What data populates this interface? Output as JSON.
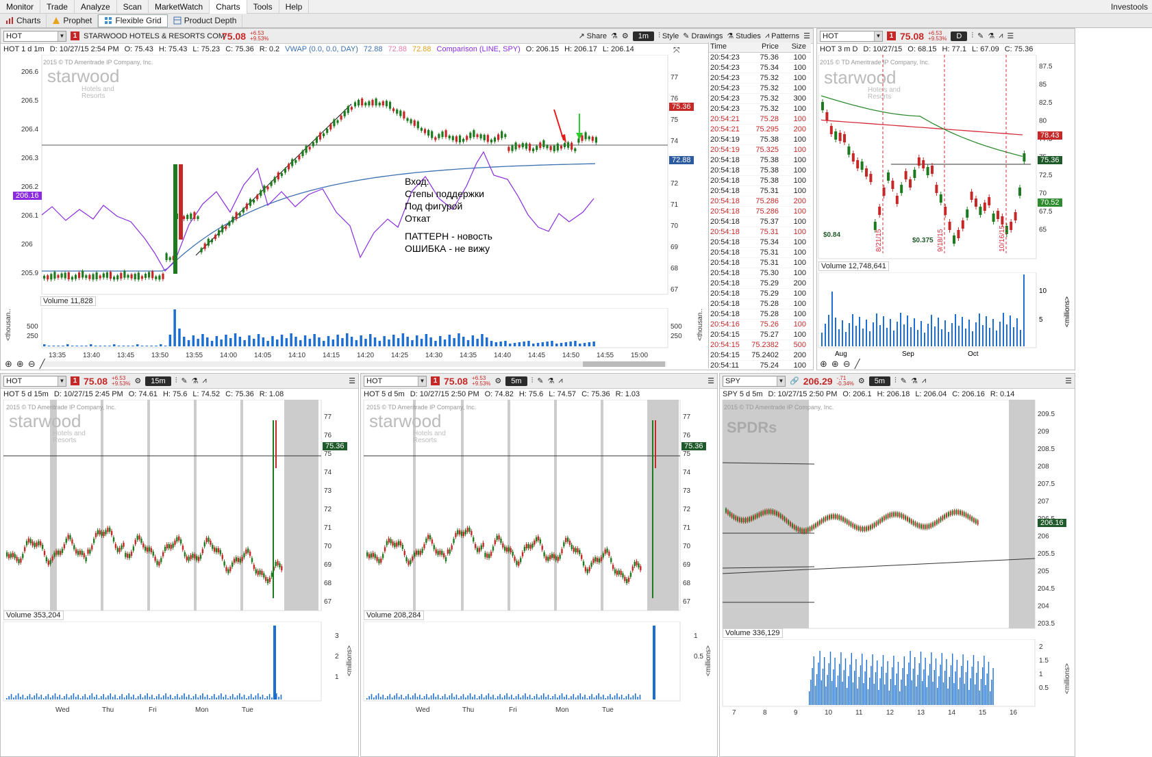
{
  "menubar": {
    "items": [
      "Monitor",
      "Trade",
      "Analyze",
      "Scan",
      "MarketWatch",
      "Charts",
      "Tools",
      "Help"
    ],
    "active": "Charts",
    "brand": "Investools"
  },
  "subtabs": {
    "items": [
      "Charts",
      "Prophet",
      "Flexible Grid",
      "Product Depth"
    ],
    "active": "Flexible Grid"
  },
  "main_chart": {
    "symbol": "HOT",
    "alert_count": "1",
    "company_name": "STARWOOD HOTELS & RESORTS COM",
    "last_price": "75.08",
    "change": "+6.53",
    "change_pct": "+9.53%",
    "timeframe": "1m",
    "toolbar": {
      "share": "Share",
      "style": "Style",
      "drawings": "Drawings",
      "studies": "Studies",
      "patterns": "Patterns"
    },
    "info": {
      "desc": "HOT 1 d 1m",
      "date": "D: 10/27/15 2:54 PM",
      "open": "O: 75.43",
      "high": "H: 75.43",
      "low": "L: 75.23",
      "close": "C: 75.36",
      "range": "R: 0.2",
      "vwap": "VWAP (0.0, 0.0, DAY)",
      "vwap_v1": "72.88",
      "vwap_v2": "72.88",
      "vwap_v3": "72.88",
      "comparison": "Comparison (LINE, SPY)",
      "cmp_open": "O: 206.15",
      "cmp_high": "H: 206.17",
      "cmp_low": "L: 206.14"
    },
    "watermark": {
      "brand": "starwood",
      "sub1": "Hotels and",
      "sub2": "Resorts",
      "copyright": "2015 © TD Ameritrade IP Company, Inc."
    },
    "right_axis": [
      "77",
      "76",
      "75",
      "74",
      "73",
      "72",
      "71",
      "70",
      "69",
      "68",
      "67"
    ],
    "left_axis": [
      "206.6",
      "206.5",
      "206.4",
      "206.3",
      "206.2",
      "206.1",
      "206",
      "205.9"
    ],
    "price_label": "75.36",
    "vwap_label": "72.88",
    "spy_label": "206.16",
    "annotation": {
      "line1": "Вход:",
      "line2": "Степы поддержки",
      "line3": "Под фигурой",
      "line4": "Откат",
      "line5": "ПАТТЕРН - новость",
      "line6": "ОШИБКА - не вижу"
    },
    "volume": {
      "label": "Volume",
      "value": "11,828",
      "axis_left": [
        "500",
        "250"
      ],
      "axis_right": [
        "500",
        "250"
      ],
      "unit": "<thousan..."
    },
    "time_axis": [
      "13:35",
      "13:40",
      "13:45",
      "13:50",
      "13:55",
      "14:00",
      "14:05",
      "14:10",
      "14:15",
      "14:20",
      "14:25",
      "14:30",
      "14:35",
      "14:40",
      "14:45",
      "14:50",
      "14:55",
      "15:00"
    ]
  },
  "time_and_sales": {
    "columns": [
      "Time",
      "Price",
      "Size"
    ],
    "rows": [
      [
        "20:54:23",
        "75.36",
        "100",
        "up"
      ],
      [
        "20:54:23",
        "75.34",
        "100",
        "up"
      ],
      [
        "20:54:23",
        "75.32",
        "100",
        "up"
      ],
      [
        "20:54:23",
        "75.32",
        "100",
        "up"
      ],
      [
        "20:54:23",
        "75.32",
        "300",
        "up"
      ],
      [
        "20:54:23",
        "75.32",
        "100",
        "up"
      ],
      [
        "20:54:21",
        "75.28",
        "100",
        "dn"
      ],
      [
        "20:54:21",
        "75.295",
        "200",
        "dn"
      ],
      [
        "20:54:19",
        "75.38",
        "100",
        "up"
      ],
      [
        "20:54:19",
        "75.325",
        "100",
        "dn"
      ],
      [
        "20:54:18",
        "75.38",
        "100",
        "up"
      ],
      [
        "20:54:18",
        "75.38",
        "100",
        "up"
      ],
      [
        "20:54:18",
        "75.38",
        "100",
        "up"
      ],
      [
        "20:54:18",
        "75.31",
        "100",
        "up"
      ],
      [
        "20:54:18",
        "75.286",
        "200",
        "dn"
      ],
      [
        "20:54:18",
        "75.286",
        "100",
        "dn"
      ],
      [
        "20:54:18",
        "75.37",
        "100",
        "up"
      ],
      [
        "20:54:18",
        "75.31",
        "100",
        "dn"
      ],
      [
        "20:54:18",
        "75.34",
        "100",
        "up"
      ],
      [
        "20:54:18",
        "75.31",
        "100",
        "up"
      ],
      [
        "20:54:18",
        "75.31",
        "100",
        "up"
      ],
      [
        "20:54:18",
        "75.30",
        "100",
        "up"
      ],
      [
        "20:54:18",
        "75.29",
        "200",
        "up"
      ],
      [
        "20:54:18",
        "75.29",
        "100",
        "up"
      ],
      [
        "20:54:18",
        "75.28",
        "100",
        "up"
      ],
      [
        "20:54:18",
        "75.28",
        "100",
        "up"
      ],
      [
        "20:54:16",
        "75.26",
        "100",
        "dn"
      ],
      [
        "20:54:15",
        "75.27",
        "100",
        "up"
      ],
      [
        "20:54:15",
        "75.2382",
        "500",
        "dn"
      ],
      [
        "20:54:15",
        "75.2402",
        "200",
        "up"
      ],
      [
        "20:54:11",
        "75.24",
        "100",
        "up"
      ]
    ]
  },
  "daily_chart": {
    "symbol": "HOT",
    "alert_count": "1",
    "last_price": "75.08",
    "change": "+6.53",
    "change_pct": "+9.53%",
    "timeframe": "D",
    "info": {
      "desc": "HOT 3 m D",
      "date": "D: 10/27/15",
      "open": "O: 68.15",
      "high": "H: 77.1",
      "low": "L: 67.09",
      "close": "C: 75.36"
    },
    "right_axis": [
      "87.5",
      "85",
      "82.5",
      "80",
      "77.5",
      "75",
      "72.5",
      "70",
      "67.5",
      "65"
    ],
    "labels": {
      "red_ma": "78.43",
      "price": "75.36",
      "green_ma": "70.52"
    },
    "events": [
      {
        "date": "8/21/15",
        "div": "$0.84"
      },
      {
        "date": "9/18/15",
        "div": "$0.375"
      },
      {
        "date": "10/16/15",
        "div": ""
      }
    ],
    "volume": {
      "label": "Volume",
      "value": "12,748,641",
      "axis": [
        "10",
        "5"
      ],
      "unit": "<millions>"
    },
    "time_axis": [
      "Aug",
      "Sep",
      "Oct"
    ]
  },
  "chart_15m": {
    "symbol": "HOT",
    "alert_count": "1",
    "last_price": "75.08",
    "change": "+6.53",
    "change_pct": "+9.53%",
    "timeframe": "15m",
    "info": {
      "desc": "HOT 5 d 15m",
      "date": "D: 10/27/15 2:45 PM",
      "open": "O: 74.61",
      "high": "H: 75.6",
      "low": "L: 74.52",
      "close": "C: 75.36",
      "range": "R: 1.08"
    },
    "right_axis": [
      "77",
      "76",
      "75",
      "74",
      "73",
      "72",
      "71",
      "70",
      "69",
      "68",
      "67"
    ],
    "price_label": "75.36",
    "volume": {
      "label": "Volume",
      "value": "353,204",
      "axis": [
        "3",
        "2",
        "1"
      ],
      "unit": "<millions>"
    },
    "time_axis": [
      "Wed",
      "Thu",
      "Fri",
      "Mon",
      "Tue"
    ]
  },
  "chart_5m": {
    "symbol": "HOT",
    "alert_count": "1",
    "last_price": "75.08",
    "change": "+6.53",
    "change_pct": "+9.53%",
    "timeframe": "5m",
    "info": {
      "desc": "HOT 5 d 5m",
      "date": "D: 10/27/15 2:50 PM",
      "open": "O: 74.82",
      "high": "H: 75.6",
      "low": "L: 74.57",
      "close": "C: 75.36",
      "range": "R: 1.03"
    },
    "right_axis": [
      "77",
      "76",
      "75",
      "74",
      "73",
      "72",
      "71",
      "70",
      "69",
      "68",
      "67"
    ],
    "price_label": "75.36",
    "volume": {
      "label": "Volume",
      "value": "208,284",
      "axis": [
        "1",
        "0.5"
      ],
      "unit": "<millions>"
    },
    "time_axis": [
      "Wed",
      "Thu",
      "Fri",
      "Mon",
      "Tue"
    ]
  },
  "chart_spy": {
    "symbol": "SPY",
    "last_price": "206.29",
    "change": "-.71",
    "change_pct": "-0.34%",
    "timeframe": "5m",
    "info": {
      "desc": "SPY 5 d 5m",
      "date": "D: 10/27/15 2:50 PM",
      "open": "O: 206.1",
      "high": "H: 206.18",
      "low": "L: 206.04",
      "close": "C: 206.16",
      "range": "R: 0.14"
    },
    "watermark": {
      "brand": "SPDRs",
      "copyright": "2015 © TD Ameritrade IP Company, Inc."
    },
    "right_axis": [
      "209.5",
      "209",
      "208.5",
      "208",
      "207.5",
      "207",
      "206.5",
      "206",
      "205.5",
      "205",
      "204.5",
      "204",
      "203.5"
    ],
    "price_label": "206.16",
    "volume": {
      "label": "Volume",
      "value": "336,129",
      "axis": [
        "2",
        "1.5",
        "1",
        "0.5"
      ],
      "unit": "<millions>"
    },
    "time_axis": [
      "7",
      "8",
      "9",
      "10",
      "11",
      "12",
      "13",
      "14",
      "15",
      "16"
    ]
  },
  "colors": {
    "up": "#1e7a1e",
    "down": "#c62828",
    "vwap": "#3a6fb0",
    "spy_line": "#8a2be2",
    "volume": "#1c6fd1"
  }
}
